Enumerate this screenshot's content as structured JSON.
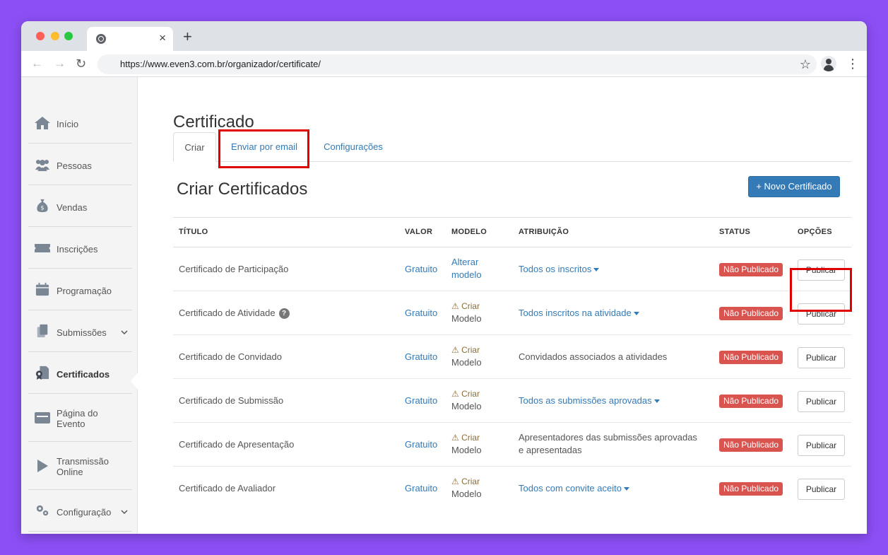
{
  "browser": {
    "tab_close": "×",
    "new_tab": "+",
    "url": "https://www.even3.com.br/organizador/certificate/",
    "back_icon": "←",
    "forward_icon": "→",
    "reload_icon": "↻",
    "star_icon": "☆",
    "menu_icon": "⋮"
  },
  "sidebar": {
    "items": [
      {
        "label": "Início",
        "icon": "home-icon"
      },
      {
        "label": "Pessoas",
        "icon": "people-icon"
      },
      {
        "label": "Vendas",
        "icon": "money-bag-icon"
      },
      {
        "label": "Inscrições",
        "icon": "ticket-icon"
      },
      {
        "label": "Programação",
        "icon": "calendar-icon"
      },
      {
        "label": "Submissões",
        "icon": "documents-icon"
      },
      {
        "label": "Certificados",
        "icon": "certificate-icon"
      },
      {
        "label": "Página do",
        "label2": "Evento",
        "icon": "page-icon"
      },
      {
        "label": "Transmissão",
        "label2": "Online",
        "icon": "play-icon"
      },
      {
        "label": "Configuração",
        "icon": "gears-icon"
      }
    ],
    "active": "Certificados",
    "chevron": "❯"
  },
  "page": {
    "title": "Certificado",
    "tabs": [
      "Criar",
      "Enviar por email",
      "Configurações"
    ],
    "section_title": "Criar Certificados",
    "new_button": "+ Novo Certificado"
  },
  "table": {
    "headers": [
      "TÍTULO",
      "VALOR",
      "MODELO",
      "ATRIBUIÇÃO",
      "STATUS",
      "OPÇÕES"
    ],
    "rows": [
      {
        "title": "Certificado de Participação",
        "value": "Gratuito",
        "model1": "Alterar",
        "model2": "modelo",
        "attribution": "Todos os inscritos",
        "status": "Não Publicado",
        "action": "Publicar"
      },
      {
        "title": "Certificado de Atividade",
        "help": "?",
        "value": "Gratuito",
        "model1": "⚠ Criar",
        "model2": "Modelo",
        "attribution": "Todos inscritos na atividade",
        "status": "Não Publicado",
        "action": "Publicar"
      },
      {
        "title": "Certificado de Convidado",
        "value": "Gratuito",
        "model1": "⚠ Criar",
        "model2": "Modelo",
        "attribution": "Convidados associados a atividades",
        "status": "Não Publicado",
        "action": "Publicar"
      },
      {
        "title": "Certificado de Submissão",
        "value": "Gratuito",
        "model1": "⚠ Criar",
        "model2": "Modelo",
        "attribution": "Todos as submissões aprovadas",
        "status": "Não Publicado",
        "action": "Publicar"
      },
      {
        "title": "Certificado de Apresentação",
        "value": "Gratuito",
        "model1": "⚠ Criar",
        "model2": "Modelo",
        "attribution": "Apresentadores das submissões aprovadas",
        "attribution2": "e apresentadas",
        "status": "Não Publicado",
        "action": "Publicar"
      },
      {
        "title": "Certificado de Avaliador",
        "value": "Gratuito",
        "model1": "⚠ Criar",
        "model2": "Modelo",
        "attribution": "Todos com convite aceito",
        "status": "Não Publicado",
        "action": "Publicar"
      }
    ]
  },
  "colors": {
    "background": "#8c4ff5",
    "highlight": "#e00000",
    "primary": "#337ab7",
    "danger": "#d9534f"
  }
}
